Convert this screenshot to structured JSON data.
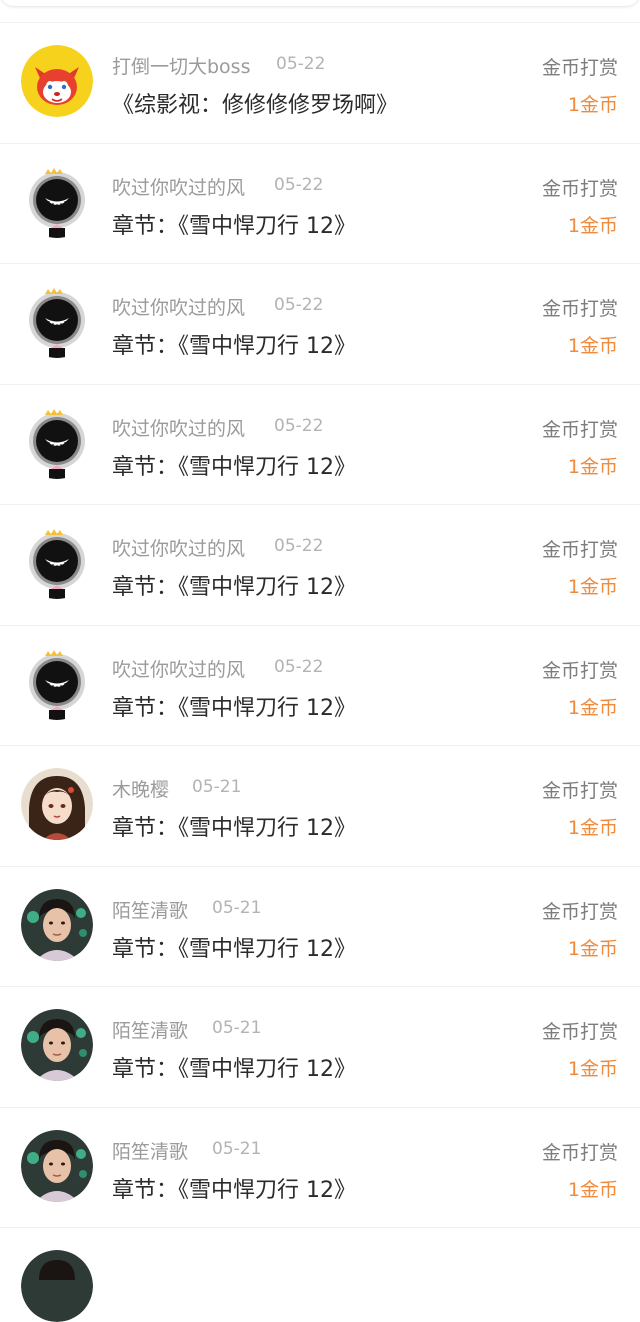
{
  "reward_type_label": "金币打赏",
  "records": [
    {
      "user": "打倒一切大boss",
      "date": "05-22",
      "title": "《综影视：修修修修罗场啊》",
      "amount": "1金币",
      "avatar": "fox-avatar-icon"
    },
    {
      "user": "吹过你吹过的风",
      "date": "05-22",
      "title": "章节：《雪中悍刀行 12》",
      "amount": "1金币",
      "avatar": "black-fluffy-ball-avatar-icon"
    },
    {
      "user": "吹过你吹过的风",
      "date": "05-22",
      "title": "章节：《雪中悍刀行 12》",
      "amount": "1金币",
      "avatar": "black-fluffy-ball-avatar-icon"
    },
    {
      "user": "吹过你吹过的风",
      "date": "05-22",
      "title": "章节：《雪中悍刀行 12》",
      "amount": "1金币",
      "avatar": "black-fluffy-ball-avatar-icon"
    },
    {
      "user": "吹过你吹过的风",
      "date": "05-22",
      "title": "章节：《雪中悍刀行 12》",
      "amount": "1金币",
      "avatar": "black-fluffy-ball-avatar-icon"
    },
    {
      "user": "吹过你吹过的风",
      "date": "05-22",
      "title": "章节：《雪中悍刀行 12》",
      "amount": "1金币",
      "avatar": "black-fluffy-ball-avatar-icon"
    },
    {
      "user": "木晚樱",
      "date": "05-21",
      "title": "章节：《雪中悍刀行 12》",
      "amount": "1金币",
      "avatar": "illustrated-girl-avatar-icon"
    },
    {
      "user": "陌笙清歌",
      "date": "05-21",
      "title": "章节：《雪中悍刀行 12》",
      "amount": "1金币",
      "avatar": "young-man-photo-avatar-icon"
    },
    {
      "user": "陌笙清歌",
      "date": "05-21",
      "title": "章节：《雪中悍刀行 12》",
      "amount": "1金币",
      "avatar": "young-man-photo-avatar-icon"
    },
    {
      "user": "陌笙清歌",
      "date": "05-21",
      "title": "章节：《雪中悍刀行 12》",
      "amount": "1金币",
      "avatar": "young-man-photo-avatar-icon"
    }
  ],
  "colors": {
    "amount": "#f08a3c",
    "name": "#9b9b9b",
    "title": "#2b2b2b",
    "type": "#7d7d7d"
  }
}
